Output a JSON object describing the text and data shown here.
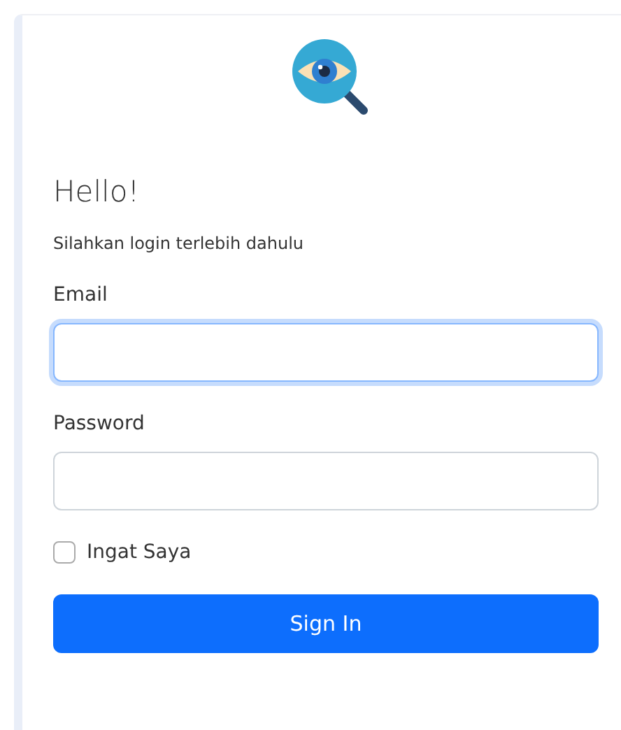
{
  "heading": "Hello!",
  "subtitle": "Silahkan login terlebih dahulu",
  "fields": [
    {
      "label": "Email",
      "focused": true
    },
    {
      "label": "Password",
      "focused": false
    }
  ],
  "remember": {
    "label": "Ingat Saya",
    "checked": false
  },
  "submit": "Sign In"
}
